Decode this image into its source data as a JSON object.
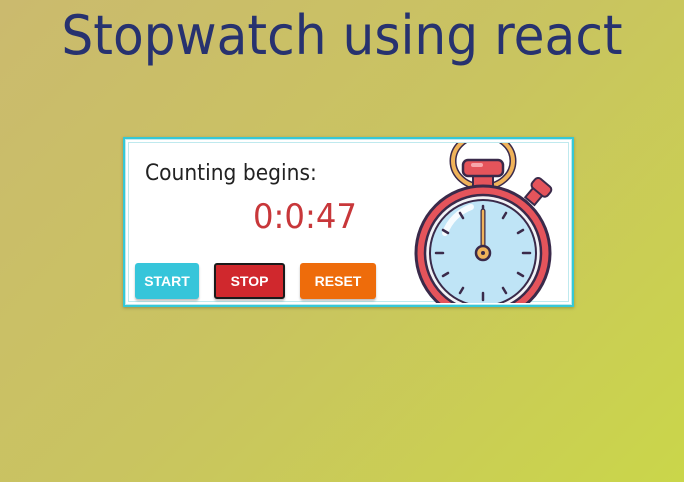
{
  "page": {
    "title": "Stopwatch using react"
  },
  "stopwatch": {
    "label": "Counting begins:",
    "time": "0:0:47",
    "buttons": {
      "start": "START",
      "stop": "STOP",
      "reset": "RESET"
    },
    "image_icon": "stopwatch-illustration"
  },
  "colors": {
    "title": "#27326f",
    "time": "#c8373a",
    "start": "#36c5da",
    "stop": "#d0282d",
    "reset": "#ee6c0b",
    "card_border": "#36c8d6"
  }
}
